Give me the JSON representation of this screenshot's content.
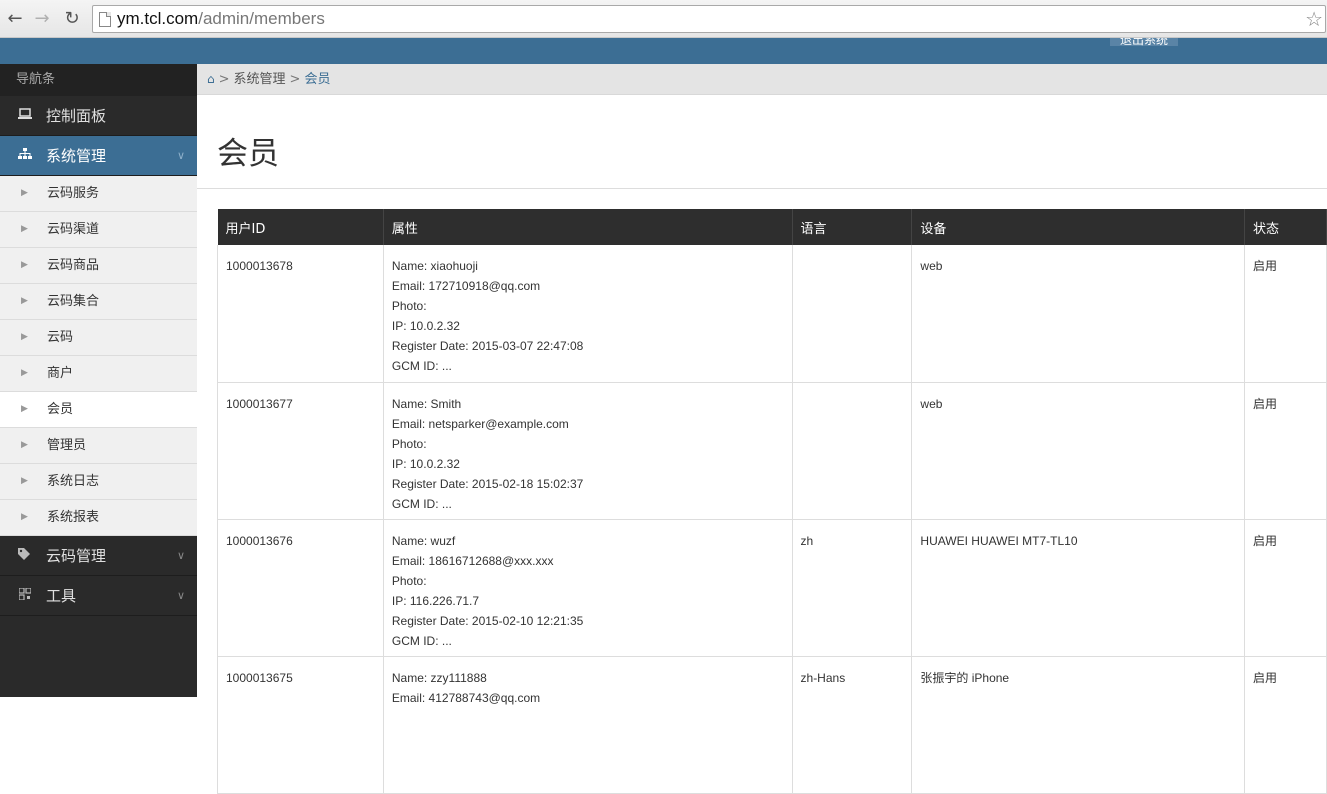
{
  "browser": {
    "url_domain": "ym.tcl.com",
    "url_path": "/admin/members"
  },
  "header": {
    "logout_label": "退出系统"
  },
  "sidebar": {
    "title": "导航条",
    "menus": [
      {
        "label": "控制面板",
        "icon": "laptop-icon"
      },
      {
        "label": "系统管理",
        "icon": "sitemap-icon"
      },
      {
        "label": "云码管理",
        "icon": "tags-icon"
      },
      {
        "label": "工具",
        "icon": "qrcode-icon"
      }
    ],
    "sub_items": [
      {
        "label": "云码服务"
      },
      {
        "label": "云码渠道"
      },
      {
        "label": "云码商品"
      },
      {
        "label": "云码集合"
      },
      {
        "label": "云码"
      },
      {
        "label": "商户"
      },
      {
        "label": "会员"
      },
      {
        "label": "管理员"
      },
      {
        "label": "系统日志"
      },
      {
        "label": "系统报表"
      }
    ]
  },
  "breadcrumb": {
    "items": [
      "系统管理",
      "会员"
    ]
  },
  "page": {
    "title": "会员"
  },
  "table": {
    "columns": [
      "用户ID",
      "属性",
      "语言",
      "设备",
      "状态"
    ],
    "rows": [
      {
        "id": "1000013678",
        "attrs": [
          "Name: xiaohuoji",
          "Email: 172710918@qq.com",
          "Photo:",
          "IP: 10.0.2.32",
          "Register Date: 2015-03-07 22:47:08",
          "GCM ID: ..."
        ],
        "lang": "",
        "device": "web",
        "status": "启用"
      },
      {
        "id": "1000013677",
        "attrs": [
          "Name: Smith",
          "Email: netsparker@example.com",
          "Photo:",
          "IP: 10.0.2.32",
          "Register Date: 2015-02-18 15:02:37",
          "GCM ID: ..."
        ],
        "lang": "",
        "device": "web",
        "status": "启用"
      },
      {
        "id": "1000013676",
        "attrs": [
          "Name: wuzf",
          "Email: 18616712688@xxx.xxx",
          "Photo:",
          "IP: 116.226.71.7",
          "Register Date: 2015-02-10 12:21:35",
          "GCM ID: ..."
        ],
        "lang": "zh",
        "device": "HUAWEI HUAWEI MT7-TL10",
        "status": "启用"
      },
      {
        "id": "1000013675",
        "attrs": [
          "Name: zzy111888",
          "Email: 412788743@qq.com"
        ],
        "lang": "zh-Hans",
        "device": "张振宇的 iPhone",
        "status": "启用"
      }
    ]
  }
}
